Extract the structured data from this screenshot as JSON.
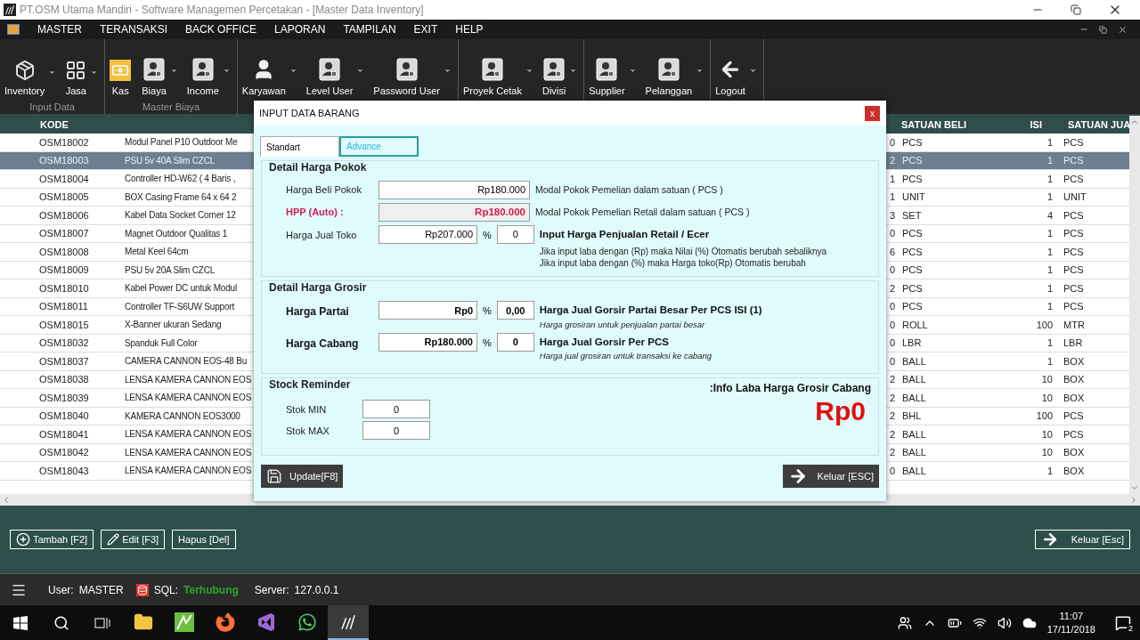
{
  "window": {
    "title": "PT.OSM Utama Mandiri - Software Managemen Percetakan - [Master Data Inventory]"
  },
  "menu": [
    "MASTER",
    "TERANSAKSI",
    "BACK OFFICE",
    "LAPORAN",
    "TAMPILAN",
    "EXIT",
    "HELP"
  ],
  "toolbar": [
    {
      "label": "Input Data",
      "items": [
        {
          "label": "Inventory",
          "kind": "dolly",
          "dropdown": true
        },
        {
          "label": "Jasa",
          "kind": "grid",
          "dropdown": true
        }
      ]
    },
    {
      "label": "Master Biaya",
      "items": [
        {
          "label": "Kas",
          "kind": "cash",
          "dropdown": false
        },
        {
          "label": "Biaya",
          "kind": "card",
          "dropdown": true
        },
        {
          "label": "Income",
          "kind": "card",
          "dropdown": true
        }
      ]
    },
    {
      "items": [
        {
          "label": "Karyawan",
          "kind": "person",
          "dropdown": true
        },
        {
          "label": "Level User",
          "kind": "card",
          "dropdown": true
        },
        {
          "label": "Password User",
          "kind": "card",
          "dropdown": true
        }
      ]
    },
    {
      "items": [
        {
          "label": "Proyek Cetak",
          "kind": "card",
          "dropdown": true
        },
        {
          "label": "Divisi",
          "kind": "card",
          "dropdown": true
        }
      ]
    },
    {
      "items": [
        {
          "label": "Supplier",
          "kind": "card",
          "dropdown": true
        },
        {
          "label": "Pelanggan",
          "kind": "card",
          "dropdown": true
        }
      ]
    },
    {
      "items": [
        {
          "label": "Logout",
          "kind": "back",
          "dropdown": true
        }
      ]
    }
  ],
  "table": {
    "columns": {
      "kode": "KODE",
      "satuan_beli": "SATUAN BELI",
      "isi": "ISI",
      "satuan_jual": "SATUAN JUA"
    },
    "rows": [
      {
        "kode": "OSM18002",
        "nama": "Modul Panel P10 Outdoor Me",
        "column_3": "0",
        "satuan_beli": "PCS",
        "isi": "1",
        "satuan_jual": "PCS",
        "selected": false
      },
      {
        "kode": "OSM18003",
        "nama": "PSU 5v 40A Slim CZCL",
        "column_3": "2",
        "satuan_beli": "PCS",
        "isi": "1",
        "satuan_jual": "PCS",
        "selected": true
      },
      {
        "kode": "OSM18004",
        "nama": "Controller HD-W62 ( 4 Baris ,",
        "column_3": "1",
        "satuan_beli": "PCS",
        "isi": "1",
        "satuan_jual": "PCS",
        "selected": false
      },
      {
        "kode": "OSM18005",
        "nama": "BOX Casing  Frame 64 x 64 2",
        "column_3": "1",
        "satuan_beli": "UNIT",
        "isi": "1",
        "satuan_jual": "UNIT",
        "selected": false
      },
      {
        "kode": "OSM18006",
        "nama": "Kabel Data Socket Corner 12",
        "column_3": "3",
        "satuan_beli": "SET",
        "isi": "4",
        "satuan_jual": "PCS",
        "selected": false
      },
      {
        "kode": "OSM18007",
        "nama": "Magnet Outdoor Qualitas 1",
        "column_3": "0",
        "satuan_beli": "PCS",
        "isi": "1",
        "satuan_jual": "PCS",
        "selected": false
      },
      {
        "kode": "OSM18008",
        "nama": "Metal Keel 64cm",
        "column_3": "6",
        "satuan_beli": "PCS",
        "isi": "1",
        "satuan_jual": "PCS",
        "selected": false
      },
      {
        "kode": "OSM18009",
        "nama": "PSU 5v 20A Slim CZCL",
        "column_3": "0",
        "satuan_beli": "PCS",
        "isi": "1",
        "satuan_jual": "PCS",
        "selected": false
      },
      {
        "kode": "OSM18010",
        "nama": "Kabel Power DC untuk Modul",
        "column_3": "2",
        "satuan_beli": "PCS",
        "isi": "1",
        "satuan_jual": "PCS",
        "selected": false
      },
      {
        "kode": "OSM18011",
        "nama": "Controller TF-S6UW Support",
        "column_3": "0",
        "satuan_beli": "PCS",
        "isi": "1",
        "satuan_jual": "PCS",
        "selected": false
      },
      {
        "kode": "OSM18015",
        "nama": "X-Banner ukuran Sedang",
        "column_3": "0",
        "satuan_beli": "ROLL",
        "isi": "100",
        "satuan_jual": "MTR",
        "selected": false
      },
      {
        "kode": "OSM18032",
        "nama": "Spanduk Full Color",
        "column_3": "0",
        "satuan_beli": "LBR",
        "isi": "1",
        "satuan_jual": "LBR",
        "selected": false
      },
      {
        "kode": "OSM18037",
        "nama": "CAMERA CANNON EOS-48 Bu",
        "column_3": "0",
        "satuan_beli": "BALL",
        "isi": "1",
        "satuan_jual": "BOX",
        "selected": false
      },
      {
        "kode": "OSM18038",
        "nama": "LENSA KAMERA CANNON EOS",
        "column_3": "2",
        "satuan_beli": "BALL",
        "isi": "10",
        "satuan_jual": "BOX",
        "selected": false
      },
      {
        "kode": "OSM18039",
        "nama": "LENSA KAMERA CANNON EOS",
        "column_3": "2",
        "satuan_beli": "BALL",
        "isi": "10",
        "satuan_jual": "BOX",
        "selected": false
      },
      {
        "kode": "OSM18040",
        "nama": "KAMERA CANNON EOS3000",
        "column_3": "2",
        "satuan_beli": "BHL",
        "isi": "100",
        "satuan_jual": "PCS",
        "selected": false
      },
      {
        "kode": "OSM18041",
        "nama": "LENSA KAMERA CANNON EOS",
        "column_3": "2",
        "satuan_beli": "BALL",
        "isi": "10",
        "satuan_jual": "PCS",
        "selected": false
      },
      {
        "kode": "OSM18042",
        "nama": "LENSA KAMERA CANNON EOS",
        "column_3": "2",
        "satuan_beli": "BALL",
        "isi": "10",
        "satuan_jual": "BOX",
        "selected": false
      },
      {
        "kode": "OSM18043",
        "nama": "LENSA KAMERA CANNON EOS",
        "column_3": "0",
        "satuan_beli": "BALL",
        "isi": "1",
        "satuan_jual": "BOX",
        "selected": false
      }
    ]
  },
  "dialog": {
    "title": "INPUT DATA BARANG",
    "close": "x",
    "tabs": [
      {
        "label": "Standart",
        "selected": true
      },
      {
        "label": "Advance",
        "selected": false
      }
    ],
    "pokok": {
      "title": "Detail Harga Pokok",
      "harga_beli": {
        "label": "Harga Beli Pokok",
        "value": "Rp180.000",
        "note": "Modal Pokok Pemelian dalam satuan ( PCS )"
      },
      "hpp": {
        "label": "HPP (Auto) :",
        "value": "Rp180.000",
        "note": "Modal Pokok Pemelian Retail dalam satuan ( PCS )"
      },
      "harga_jual": {
        "label": "Harga Jual Toko",
        "value": "Rp207.000",
        "percent_sign": "%",
        "percent": "0",
        "heading": "Input Harga Penjualan Retail / Ecer",
        "notes": [
          "Jika input laba dengan (Rp) maka Nilai (%) Otomatis berubah sebaliknya",
          "Jika input laba dengan (%) maka Harga toko(Rp) Otomatis berubah"
        ]
      }
    },
    "grosir": {
      "title": "Detail Harga Grosir",
      "rows": [
        {
          "label": "Harga Partai",
          "value": "Rp0",
          "percent_sign": "%",
          "percent": "0,00",
          "heading": "Harga Jual Gorsir Partai Besar Per PCS ISI (1)",
          "note": "Harga grosiran untuk penjualan partai besar"
        },
        {
          "label": "Harga Cabang",
          "value": "Rp180.000",
          "percent_sign": "%",
          "percent": "0",
          "heading": "Harga Jual Gorsir Per PCS",
          "note": "Harga jual grosiran untuk transaksi ke cabang"
        }
      ]
    },
    "stock": {
      "title": "Stock Reminder",
      "fields": [
        {
          "label": "Stok MIN",
          "value": "0"
        },
        {
          "label": "Stok MAX",
          "value": "0"
        }
      ],
      "info_label": ":Info Laba Harga Grosir Cabang",
      "info_value": "Rp0"
    },
    "update_button": "Update[F8]",
    "exit_button": "Keluar [ESC]"
  },
  "actions": {
    "left": [
      {
        "label": "Tambah [F2]",
        "kind": "add"
      },
      {
        "label": "Edit [F3]",
        "kind": "edit"
      },
      {
        "label": "Hapus [Del]",
        "kind": "plain"
      }
    ],
    "exit": "Keluar [Esc]"
  },
  "status_bar": {
    "user_label": "User:",
    "user": "MASTER",
    "sql_label": "SQL:",
    "sql_status": "Terhubung",
    "server_label": "Server:",
    "server": "127.0.0.1"
  },
  "taskbar": {
    "apps": [
      {
        "kind": "explorer",
        "active": false
      },
      {
        "kind": "green",
        "active": false
      },
      {
        "kind": "firefox",
        "active": false
      },
      {
        "kind": "studio",
        "active": false
      },
      {
        "kind": "whatsapp",
        "active": false
      },
      {
        "kind": "osm",
        "active": true
      }
    ],
    "time": "11:07",
    "date": "17/11/2018",
    "notifications": "2"
  }
}
